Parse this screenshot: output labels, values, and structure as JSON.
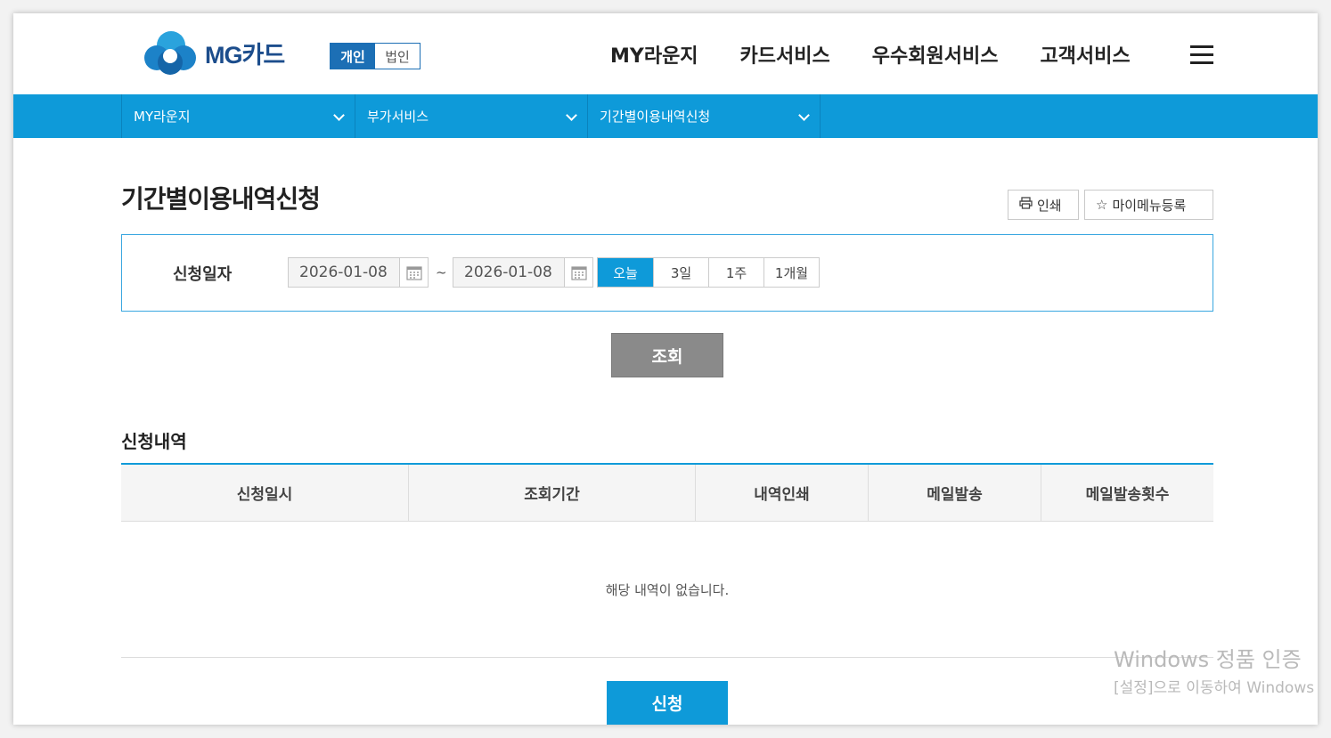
{
  "header": {
    "logo_text": "MG카드",
    "toggle": {
      "personal": "개인",
      "corporate": "법인"
    },
    "gnb": [
      "MY라운지",
      "카드서비스",
      "우수회원서비스",
      "고객서비스"
    ]
  },
  "subnav": [
    "MY라운지",
    "부가서비스",
    "기간별이용내역신청"
  ],
  "page": {
    "title": "기간별이용내역신청",
    "print_label": "인쇄",
    "mymenu_label": "마이메뉴등록"
  },
  "search": {
    "label": "신청일자",
    "date_from": "2026-01-08",
    "date_to": "2026-01-08",
    "separator": "~",
    "periods": [
      "오늘",
      "3일",
      "1주",
      "1개월"
    ],
    "active_period": "오늘",
    "query_label": "조회"
  },
  "history": {
    "title": "신청내역",
    "columns": [
      "신청일시",
      "조회기간",
      "내역인쇄",
      "메일발송",
      "메일발송횟수"
    ],
    "empty_message": "해당 내역이 없습니다."
  },
  "apply_label": "신청",
  "watermark": {
    "line1": "Windows 정품 인증",
    "line2": "[설정]으로 이동하여 Windows"
  },
  "colors": {
    "primary": "#0e9ad9",
    "brand_dark": "#1c6fb5",
    "query_button": "#8a8a8a"
  }
}
